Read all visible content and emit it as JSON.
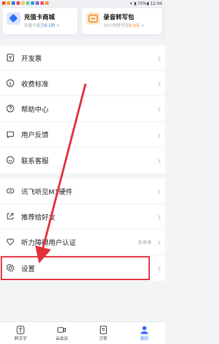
{
  "status_bar": {
    "text": "✶ ▮ 75%▮ 12:04",
    "app_dot_colors": [
      "#e8512f",
      "#f5a623",
      "#3b6fd8",
      "#e84a5f",
      "#f2c94c",
      "#6fcf97",
      "#2d9cdb",
      "#9b51e0",
      "#eb5757",
      "#f2994a"
    ]
  },
  "promo_cards": [
    {
      "title": "充值卡商城",
      "sub_prefix": "充值卡低至",
      "sub_highlight": "6.1折",
      "sub_suffix": ">",
      "icon": "card-icon"
    },
    {
      "title": "录音转写包",
      "sub_prefix": "30小时转写仅",
      "sub_highlight": "9.9元",
      "sub_suffix": ">",
      "icon": "audio-pack-icon"
    }
  ],
  "menu_groups": [
    [
      {
        "label": "开发票",
        "icon": "invoice-icon"
      },
      {
        "label": "收费标准",
        "icon": "info-icon"
      },
      {
        "label": "帮助中心",
        "icon": "help-icon"
      },
      {
        "label": "用户反馈",
        "icon": "feedback-icon"
      },
      {
        "label": "联系客服",
        "icon": "chat-icon"
      }
    ],
    [
      {
        "label": "讯飞听见M1硬件",
        "icon": "hardware-icon"
      },
      {
        "label": "推荐给好友",
        "icon": "share-icon"
      },
      {
        "label": "听力障碍用户认证",
        "icon": "heart-icon",
        "status": "未申请"
      },
      {
        "label": "设置",
        "icon": "gear-icon",
        "highlighted": true
      }
    ]
  ],
  "tabbar": [
    {
      "label": "转文字",
      "icon": "transcribe-icon"
    },
    {
      "label": "云会议",
      "icon": "video-icon"
    },
    {
      "label": "订单",
      "icon": "order-icon"
    },
    {
      "label": "我的",
      "icon": "profile-icon",
      "active": true
    }
  ],
  "colors": {
    "accent": "#2f6ff5",
    "annotation": "#e0303a",
    "orange": "#e8822a"
  }
}
